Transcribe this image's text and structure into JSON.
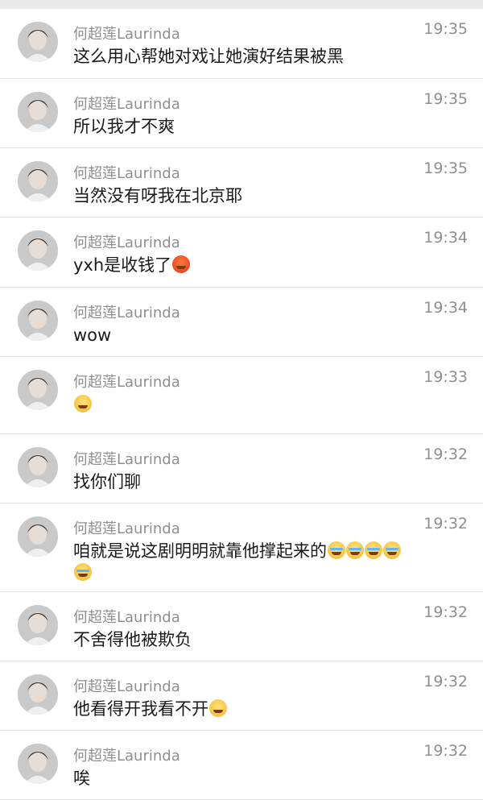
{
  "sender_name": "何超莲Laurinda",
  "messages": [
    {
      "time": "19:35",
      "text": "这么用心帮她对戏让她演好结果被黑",
      "emojis": []
    },
    {
      "time": "19:35",
      "text": "所以我才不爽",
      "emojis": []
    },
    {
      "time": "19:35",
      "text": "当然没有呀我在北京耶",
      "emojis": []
    },
    {
      "time": "19:34",
      "text": "yxh是收钱了",
      "emojis": [
        "angry-face"
      ]
    },
    {
      "time": "19:34",
      "text": "wow",
      "emojis": []
    },
    {
      "time": "19:33",
      "text": "",
      "emojis": [
        "crying-laughing-face"
      ]
    },
    {
      "time": "19:32",
      "text": "找你们聊",
      "emojis": []
    },
    {
      "time": "19:32",
      "text": "咱就是说这剧明明就靠他撑起来的",
      "emojis": [
        "crying-face",
        "crying-face",
        "crying-face",
        "crying-face"
      ],
      "second_line_emojis": [
        "crying-face"
      ]
    },
    {
      "time": "19:32",
      "text": "不舍得他被欺负",
      "emojis": []
    },
    {
      "time": "19:32",
      "text": "他看得开我看不开",
      "emojis": [
        "rolling-laughing-face"
      ]
    },
    {
      "time": "19:32",
      "text": "唉",
      "emojis": []
    }
  ]
}
